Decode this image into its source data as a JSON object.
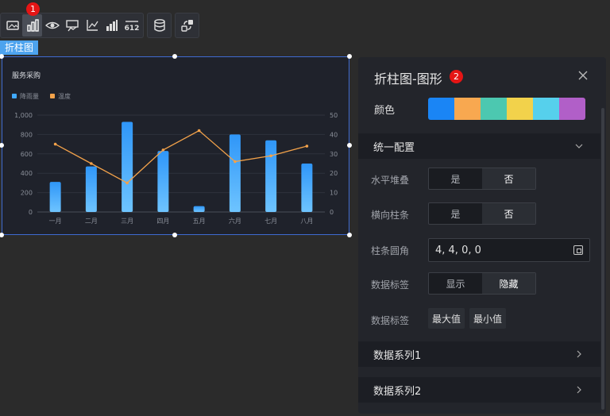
{
  "toolbar": {
    "groups": [
      [
        "image-icon",
        "bar-chart-icon",
        "eye-icon",
        "map-chart-icon",
        "line-axis-icon",
        "bar-series-icon",
        "number-icon"
      ],
      [
        "database-icon"
      ],
      [
        "swap-icon"
      ]
    ],
    "active": "bar-chart-icon",
    "badge": "1"
  },
  "widget_tag": "折柱图",
  "chart": {
    "colors": {
      "bar": "#40a9ff",
      "line": "#f3a24a",
      "text": "#8a8f99",
      "grid": "#2f333d"
    }
  },
  "chart_data": {
    "type": "bar",
    "title": "服务采购",
    "categories": [
      "一月",
      "二月",
      "三月",
      "四月",
      "五月",
      "六月",
      "七月",
      "八月"
    ],
    "series": [
      {
        "name": "降雨量",
        "type": "bar",
        "axis": "left",
        "values": [
          310,
          470,
          930,
          630,
          60,
          800,
          740,
          500
        ]
      },
      {
        "name": "温度",
        "type": "line",
        "axis": "right",
        "values": [
          35,
          25,
          15,
          32,
          42,
          26,
          29,
          34
        ]
      }
    ],
    "yLeft": {
      "ticks": [
        "0",
        "200",
        "400",
        "600",
        "800",
        "1,000"
      ],
      "range": [
        0,
        1000
      ]
    },
    "yRight": {
      "ticks": [
        "0",
        "10",
        "20",
        "30",
        "40",
        "50"
      ],
      "range": [
        0,
        50
      ]
    },
    "legend": "top-left",
    "grid": true
  },
  "panel": {
    "title": "折柱图-图形",
    "badge": "2",
    "color_label": "颜色",
    "palette": [
      "#1a85f5",
      "#f8a850",
      "#4cc8b0",
      "#f2d24b",
      "#56d0ec",
      "#b15fc8"
    ],
    "section_common": "统一配置",
    "rows": {
      "stack": {
        "label": "水平堆叠",
        "options": [
          "是",
          "否"
        ],
        "selected": "否"
      },
      "horizontal": {
        "label": "横向柱条",
        "options": [
          "是",
          "否"
        ],
        "selected": "否"
      },
      "radius": {
        "label": "柱条圆角",
        "value": "4,  4,  0,  0"
      },
      "data_label_toggle": {
        "label": "数据标签",
        "options": [
          "显示",
          "隐藏"
        ],
        "selected": "隐藏"
      },
      "data_label_extrema": {
        "label": "数据标签",
        "options": [
          "最大值",
          "最小值"
        ]
      }
    },
    "series_sections": [
      "数据系列1",
      "数据系列2"
    ]
  }
}
